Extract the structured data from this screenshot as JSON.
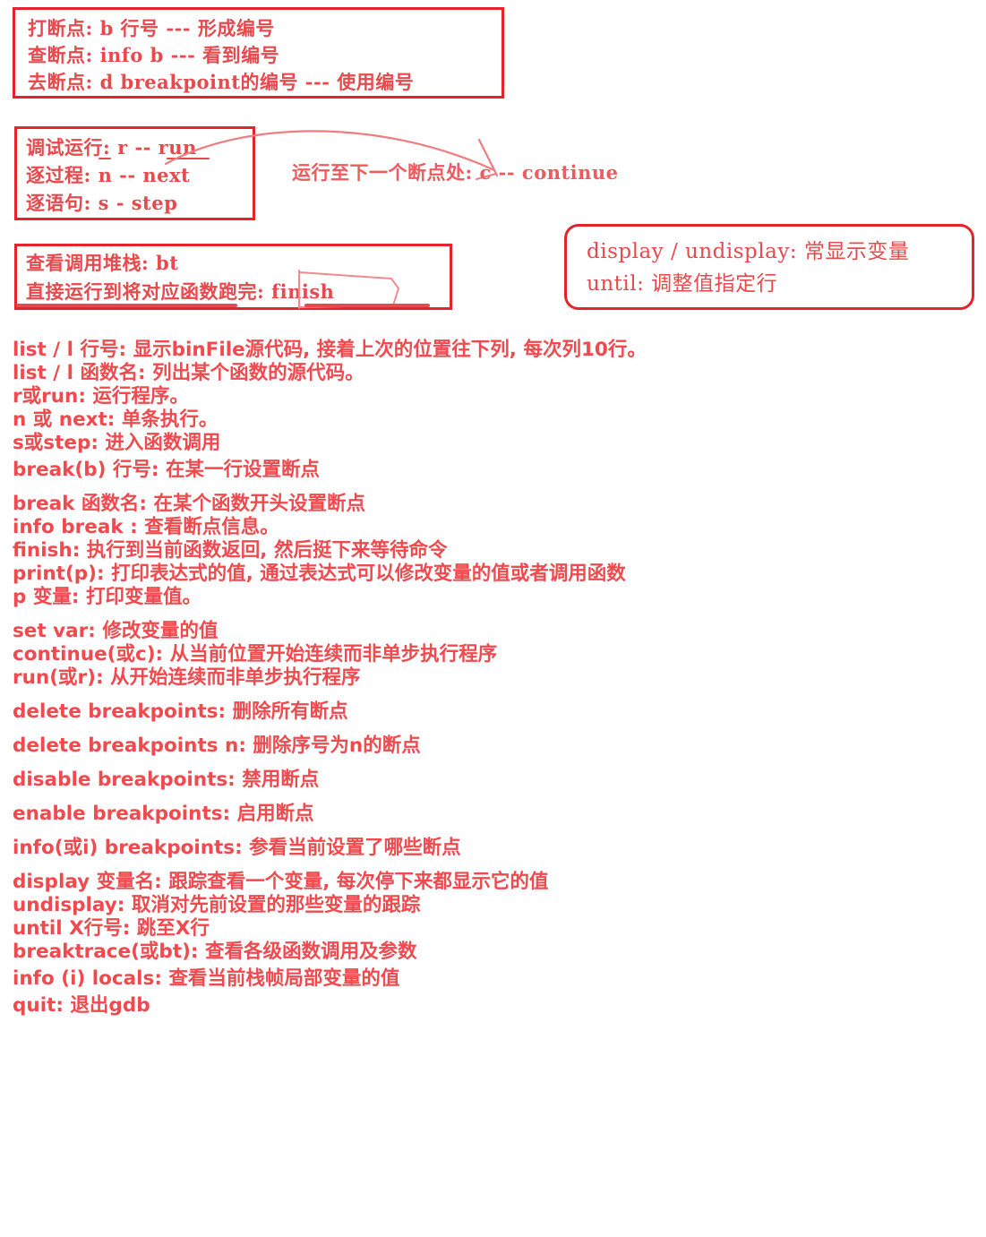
{
  "theme": {
    "ink": "#f04a4e",
    "box_border": "#e3252b",
    "background": "#ffffff"
  },
  "boxes": [
    {
      "id": "breakpoint-box",
      "lines": [
        "打断点: b 行号  --- 形成编号",
        "查断点: info b  --- 看到编号",
        "去断点: d breakpoint的编号 --- 使用编号"
      ]
    },
    {
      "id": "run-step-box",
      "lines": [
        "调试运行: r -- run",
        "逐过程: n -- next",
        "逐语句: s - step"
      ]
    },
    {
      "id": "backtrace-box",
      "lines": [
        "查看调用堆栈: bt",
        "直接运行到将对应函数跑完: finish"
      ]
    },
    {
      "id": "display-until-box",
      "lines": [
        "display / undisplay: 常显示变量",
        "until: 调整值指定行"
      ]
    }
  ],
  "annotation": {
    "continue_note": "运行至下一个断点处: c -- continue",
    "finish_highlight": "finish"
  },
  "commands": [
    "list / l 行号: 显示binFile源代码, 接着上次的位置往下列, 每次列10行。",
    "list / l 函数名: 列出某个函数的源代码。",
    "r或run: 运行程序。",
    "n 或 next: 单条执行。",
    "s或step: 进入函数调用",
    "break(b) 行号: 在某一行设置断点",
    "break 函数名: 在某个函数开头设置断点",
    "info break : 查看断点信息。",
    "finish: 执行到当前函数返回, 然后挺下来等待命令",
    "print(p): 打印表达式的值, 通过表达式可以修改变量的值或者调用函数",
    "p 变量: 打印变量值。",
    "set var: 修改变量的值",
    "continue(或c): 从当前位置开始连续而非单步执行程序",
    "run(或r): 从开始连续而非单步执行程序",
    "delete breakpoints: 删除所有断点",
    "delete breakpoints n: 删除序号为n的断点",
    "disable breakpoints: 禁用断点",
    "enable breakpoints: 启用断点",
    "info(或i) breakpoints: 参看当前设置了哪些断点",
    "display 变量名: 跟踪查看一个变量, 每次停下来都显示它的值",
    "undisplay: 取消对先前设置的那些变量的跟踪",
    "until X行号: 跳至X行",
    "breaktrace(或bt): 查看各级函数调用及参数",
    "info (i) locals: 查看当前栈帧局部变量的值",
    "quit: 退出gdb"
  ]
}
